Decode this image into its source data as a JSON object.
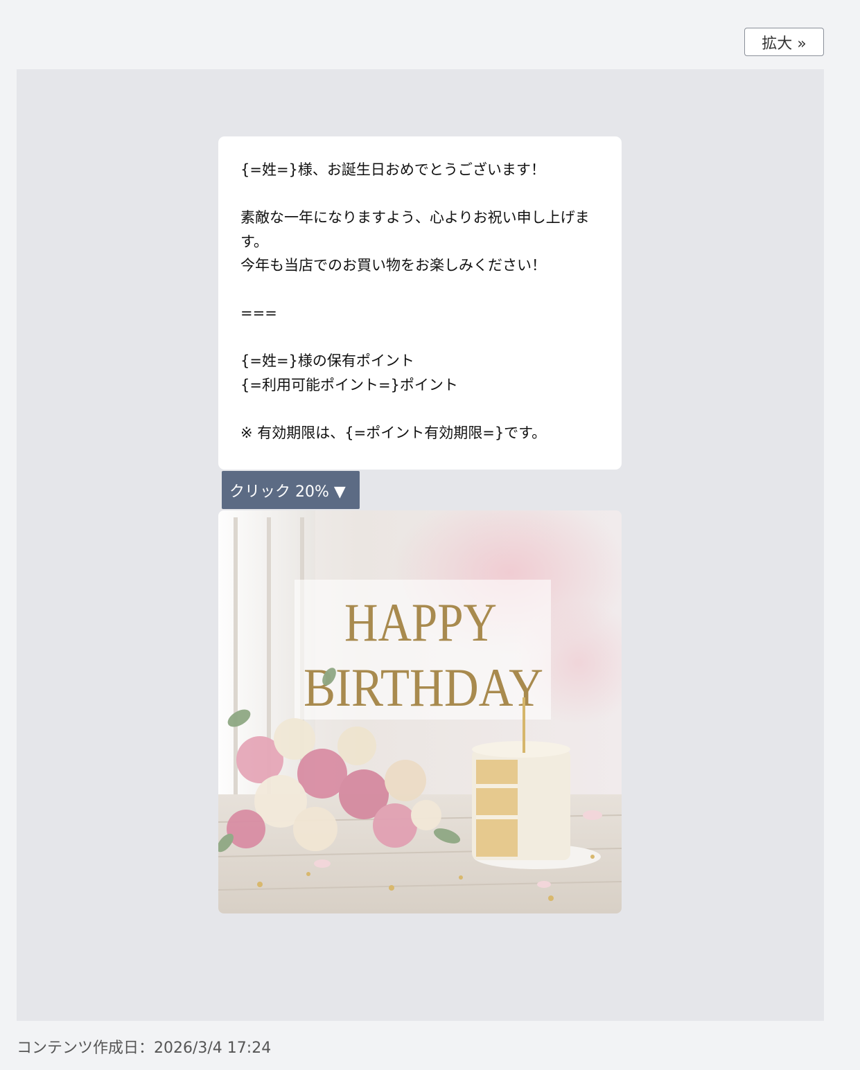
{
  "toolbar": {
    "expand_label": "拡大 »"
  },
  "message": {
    "text": "{=姓=}様、お誕生日おめでとうございます！\n\n素敵な一年になりますよう、心よりお祝い申し上げます。\n今年も当店でのお買い物をお楽しみください！\n\n===\n\n{=姓=}様の保有ポイント\n{=利用可能ポイント=}ポイント\n\n※ 有効期限は、{=ポイント有効期限=}です。"
  },
  "click_badge": {
    "label": "クリック 20% ▼"
  },
  "image": {
    "title_line1": "HAPPY",
    "title_line2": "BIRTHDAY",
    "text_color": "#a88a4e"
  },
  "footer": {
    "created_label": "コンテンツ作成日：2026/3/4 17:24"
  },
  "colors": {
    "page_bg": "#f2f3f5",
    "preview_bg": "#e5e6ea",
    "badge_bg": "#5c6b84"
  }
}
